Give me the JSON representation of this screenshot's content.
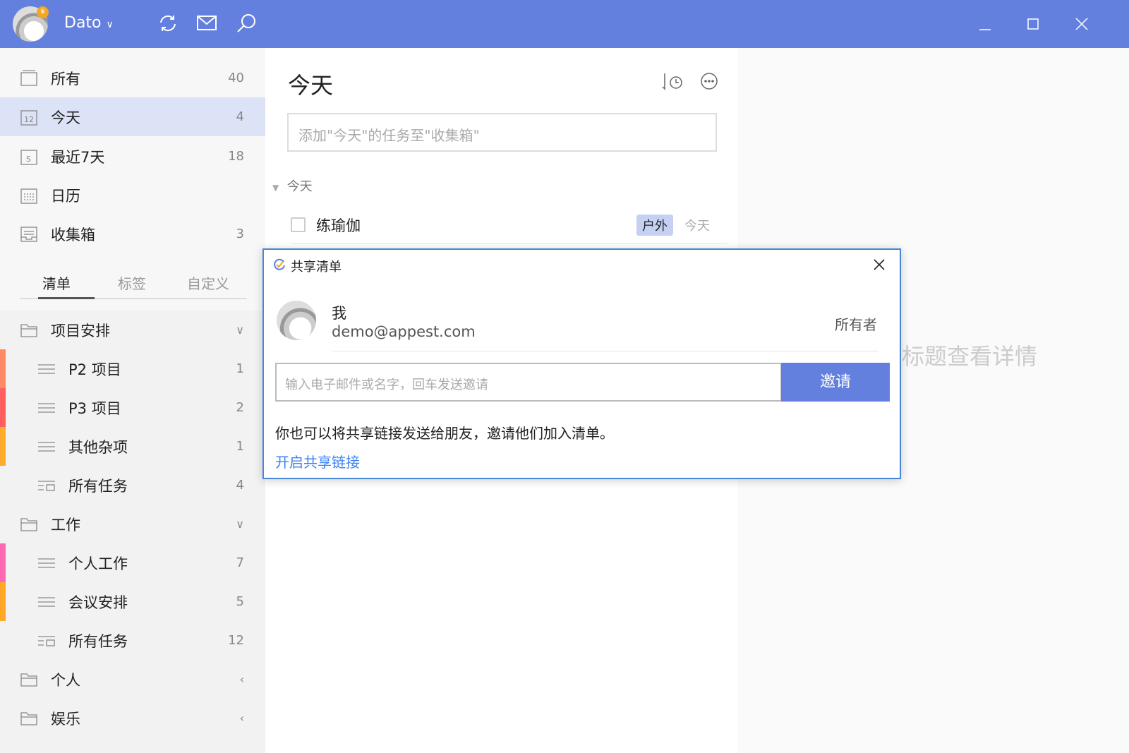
{
  "titlebar": {
    "app_name": "Dato"
  },
  "smart_lists": [
    {
      "label": "所有",
      "count": "40",
      "icon": "inbox-all-icon"
    },
    {
      "label": "今天",
      "count": "4",
      "icon": "calendar-12-icon"
    },
    {
      "label": "最近7天",
      "count": "18",
      "icon": "calendar-s-icon"
    },
    {
      "label": "日历",
      "count": "",
      "icon": "calendar-grid-icon"
    },
    {
      "label": "收集箱",
      "count": "3",
      "icon": "inbox-icon"
    }
  ],
  "tabs": [
    "清单",
    "标签",
    "自定义"
  ],
  "groups": [
    {
      "label": "项目安排",
      "items": [
        {
          "label": "P2 项目",
          "count": "1",
          "color": "#ff8a65"
        },
        {
          "label": "P3 项目",
          "count": "2",
          "color": "#ff5f5f"
        },
        {
          "label": "其他杂项",
          "count": "1",
          "color": "#ffab2e"
        },
        {
          "label": "所有任务",
          "count": "4",
          "color": ""
        }
      ]
    },
    {
      "label": "工作",
      "items": [
        {
          "label": "个人工作",
          "count": "7",
          "color": "#ff69b4"
        },
        {
          "label": "会议安排",
          "count": "5",
          "color": "#ffa726"
        },
        {
          "label": "所有任务",
          "count": "12",
          "color": ""
        }
      ]
    },
    {
      "label": "个人"
    },
    {
      "label": "娱乐"
    }
  ],
  "main": {
    "title": "今天",
    "add_placeholder": "添加\"今天\"的任务至\"收集箱\"",
    "section": "今天",
    "task": {
      "name": "练瑜伽",
      "tag": "户外",
      "date": "今天"
    }
  },
  "detail_hint": "标题查看详情",
  "dialog": {
    "title": "共享清单",
    "user_name": "我",
    "user_email": "demo@appest.com",
    "role": "所有者",
    "invite_placeholder": "输入电子邮件或名字，回车发送邀请",
    "invite_button": "邀请",
    "description": "你也可以将共享链接发送给朋友，邀请他们加入清单。",
    "share_link": "开启共享链接"
  },
  "colors": {
    "accent": "#6480df",
    "link": "#3b82f6"
  }
}
